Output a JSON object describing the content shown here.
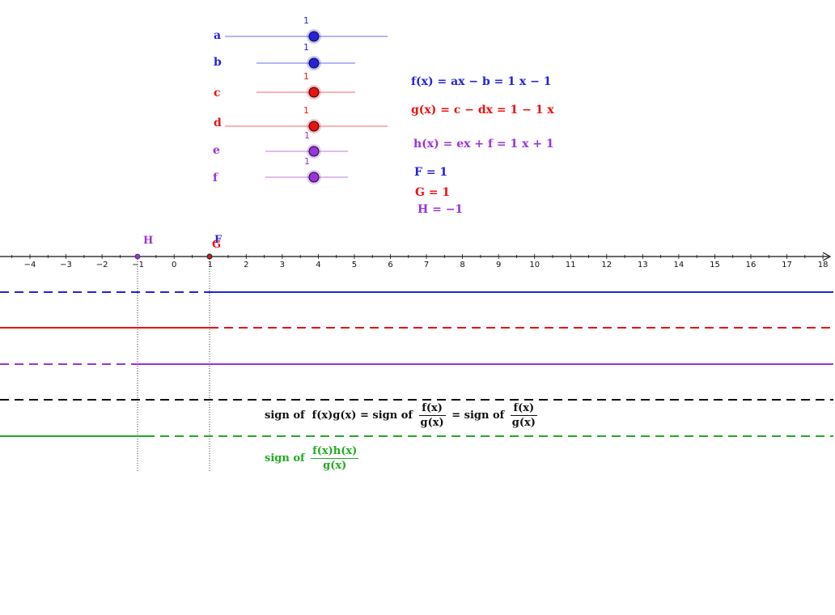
{
  "sliders": [
    {
      "name": "a",
      "value": "1",
      "color": "#2222e0"
    },
    {
      "name": "b",
      "value": "1",
      "color": "#2222e0"
    },
    {
      "name": "c",
      "value": "1",
      "color": "#ee1111"
    },
    {
      "name": "d",
      "value": "1",
      "color": "#ee1111"
    },
    {
      "name": "e",
      "value": "1",
      "color": "#9933dd"
    },
    {
      "name": "f",
      "value": "1",
      "color": "#9933dd"
    }
  ],
  "formulas": {
    "f": "f(x) = ax − b = 1 x − 1",
    "g": "g(x) = c − dx = 1 − 1 x",
    "h": "h(x) = ex + f = 1 x + 1",
    "F": "F = 1",
    "G": "G = 1",
    "H": "H = −1"
  },
  "axis": {
    "ticks": [
      "−4",
      "−3",
      "−2",
      "−1",
      "0",
      "1",
      "2",
      "3",
      "4",
      "5",
      "6",
      "7",
      "8",
      "9",
      "10",
      "11",
      "12",
      "13",
      "14",
      "15",
      "16",
      "17",
      "18"
    ]
  },
  "points": {
    "H": "H",
    "F": "F",
    "G": "G"
  },
  "sign_text": {
    "black_prefix": "sign of",
    "black_expr": "f(x)g(x) = sign of",
    "black_frac1_num": "f(x)",
    "black_frac1_den": "g(x)",
    "black_mid": "= sign of",
    "black_frac2_num": "f(x)",
    "black_frac2_den": "g(x)",
    "green_prefix": "sign of",
    "green_frac_num": "f(x)h(x)",
    "green_frac_den": "g(x)"
  },
  "colors": {
    "blue": "#2222e0",
    "red": "#ee1111",
    "purple": "#9933dd",
    "black": "#111111",
    "green": "#22aa22"
  }
}
